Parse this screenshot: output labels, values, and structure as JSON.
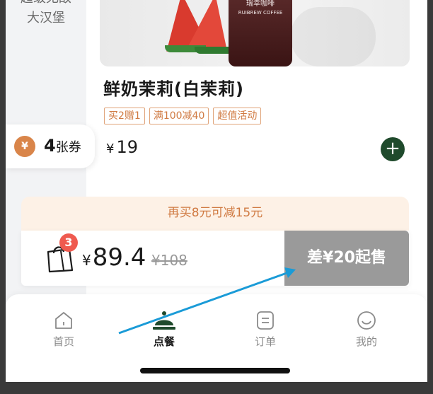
{
  "sidebar": {
    "category_line1": "超级无敌",
    "category_line2": "大汉堡"
  },
  "product": {
    "cup_logo_cn": "瑞幸咖啡",
    "cup_logo_en": "RUIBREW COFFEE",
    "name": "鲜奶茉莉(白茉莉)",
    "tags": [
      "买2赠1",
      "满100减40",
      "超值活动"
    ],
    "price_symbol": "¥",
    "price": "19",
    "add_label": "+"
  },
  "coupon": {
    "icon": "ticket-icon",
    "icon_glyph": "¥",
    "count": "4",
    "unit": "张券"
  },
  "promo": {
    "text": "再买8元可减15元"
  },
  "cart": {
    "badge": "3",
    "price_symbol": "¥",
    "total": "89.4",
    "old_price": "¥108",
    "checkout_label": "差¥20起售"
  },
  "tabbar": {
    "tabs": [
      {
        "label": "首页",
        "icon": "home-icon",
        "active": false
      },
      {
        "label": "点餐",
        "icon": "cloche-icon",
        "active": true
      },
      {
        "label": "订单",
        "icon": "order-icon",
        "active": false
      },
      {
        "label": "我的",
        "icon": "smile-icon",
        "active": false
      }
    ]
  },
  "colors": {
    "accent": "#1f4a2c",
    "tag": "#d07a42",
    "promo_bg": "#fdf1e6",
    "badge": "#ef5a4f",
    "annotation_arrow": "#1a9bd7"
  }
}
